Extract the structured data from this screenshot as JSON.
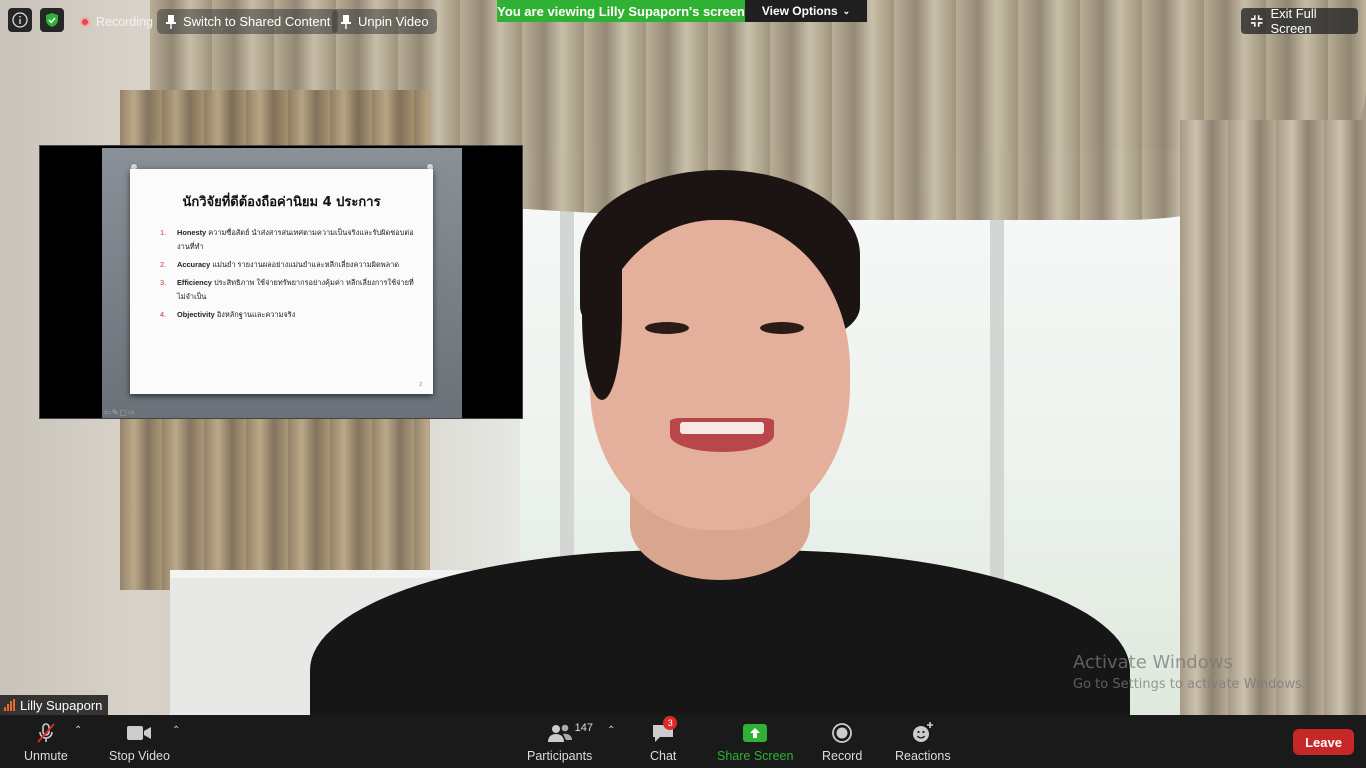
{
  "topbar": {
    "recording_label": "Recording",
    "switch_label": "Switch to Shared Content",
    "unpin_label": "Unpin Video",
    "banner_text": "You are viewing Lilly Supaporn's screen",
    "view_options_label": "View Options",
    "exit_fullscreen_label": "Exit Full Screen"
  },
  "shared_slide": {
    "title": "นักวิจัยที่ดีต้องถือค่านิยม 4 ประการ",
    "items": [
      {
        "num": "1.",
        "term": "Honesty",
        "text": " ความซื่อสัตย์ นำส่งสารสนเทศตามความเป็นจริงและรับผิดชอบต่องานที่ทำ"
      },
      {
        "num": "2.",
        "term": "Accuracy",
        "text": " แม่นยำ รายงานผลอย่างแม่นยำและหลีกเลี่ยงความผิดพลาด"
      },
      {
        "num": "3.",
        "term": "Efficiency",
        "text": " ประสิทธิภาพ ใช้จ่ายทรัพยากรอย่างคุ้มค่า หลีกเลี่ยงการใช้จ่ายที่ไม่จำเป็น"
      },
      {
        "num": "4.",
        "term": "Objectivity",
        "text": " อิงหลักฐานและความจริง"
      }
    ],
    "page_number": "2"
  },
  "speaker": {
    "name": "Lilly Supaporn"
  },
  "watermark": {
    "line1": "Activate Windows",
    "line2": "Go to Settings to activate Windows."
  },
  "toolbar": {
    "unmute_label": "Unmute",
    "stop_video_label": "Stop Video",
    "participants_label": "Participants",
    "participants_count": "147",
    "chat_label": "Chat",
    "chat_badge": "3",
    "share_label": "Share Screen",
    "record_label": "Record",
    "reactions_label": "Reactions",
    "leave_label": "Leave"
  },
  "colors": {
    "share_green": "#2fb233",
    "leave_red": "#c62828",
    "badge_red": "#e02828"
  }
}
